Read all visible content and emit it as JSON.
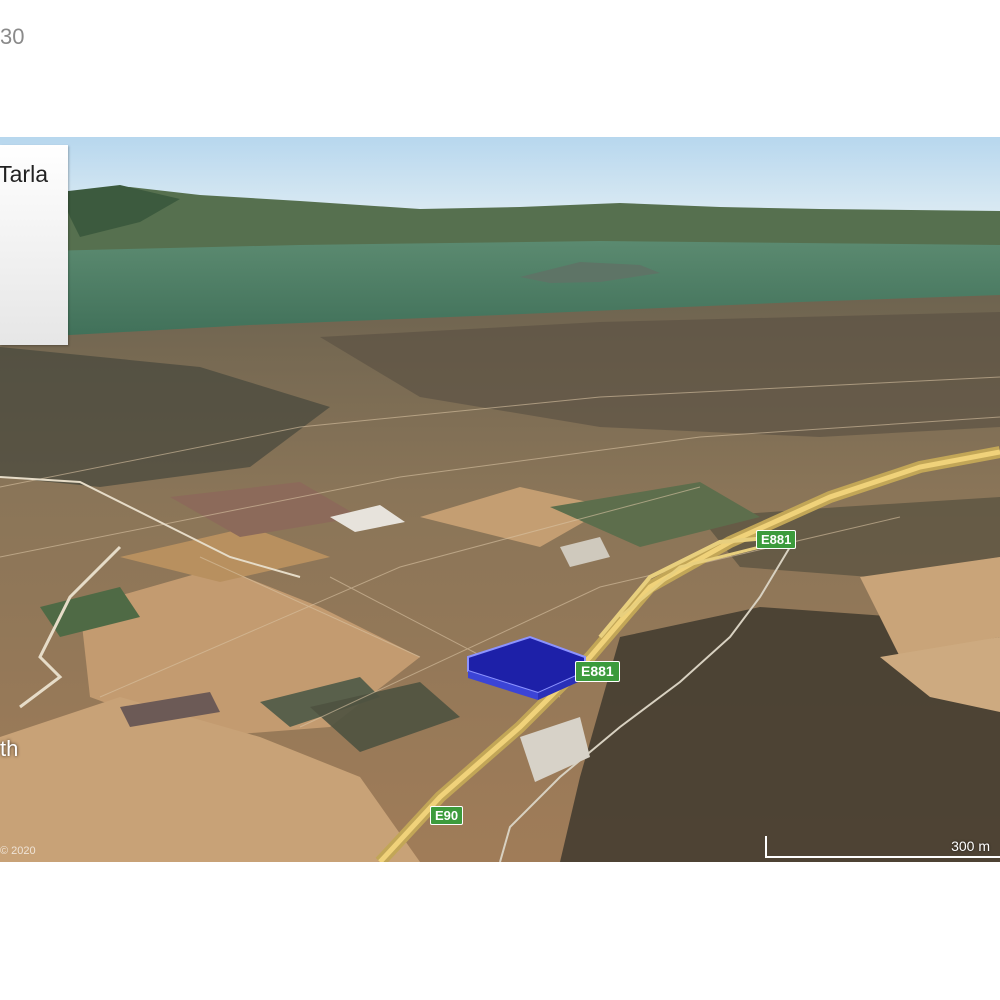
{
  "counter": "30",
  "info_panel": {
    "title": "Tarla"
  },
  "earth_label": "th",
  "attribution": "© 2020",
  "roads": {
    "e881_upper": "E881",
    "e881_lower": "E881",
    "e90": "E90"
  },
  "scale": {
    "label": "300 m"
  },
  "colors": {
    "sky": "#c4dff0",
    "lake": "#4f7f66",
    "fields": "#b38a63",
    "highway": "#e3c36a",
    "parcel": "#1d20a8",
    "shield": "#3c9b3c"
  }
}
